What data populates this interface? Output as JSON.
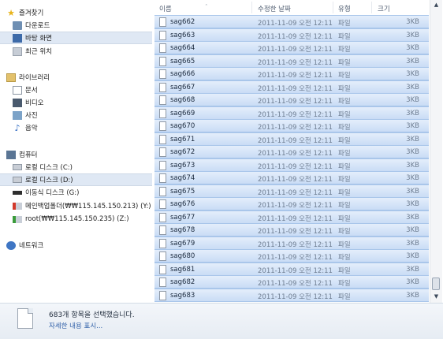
{
  "nav": {
    "favorites": {
      "header": "즐겨찾기",
      "items": [
        "다운로드",
        "바탕 화면",
        "최근 위치"
      ]
    },
    "libraries": {
      "header": "라이브러리",
      "items": [
        "문서",
        "비디오",
        "사진",
        "음악"
      ]
    },
    "computer": {
      "header": "컴퓨터",
      "items": [
        "로컬 디스크 (C:)",
        "로컬 디스크 (D:)",
        "이동식 디스크 (G:)",
        "메인백업폴더(₩₩115.145.150.213) (Y:)",
        "root(₩₩115.145.150.235) (Z:)"
      ]
    },
    "network": {
      "header": "네트워크"
    }
  },
  "columns": {
    "name": "이름",
    "date": "수정한 날짜",
    "type": "유형",
    "size": "크기"
  },
  "files": [
    {
      "name": "sag662",
      "date": "2011-11-09 오전 12:11",
      "type": "파일",
      "size": "3KB"
    },
    {
      "name": "sag663",
      "date": "2011-11-09 오전 12:11",
      "type": "파일",
      "size": "3KB"
    },
    {
      "name": "sag664",
      "date": "2011-11-09 오전 12:11",
      "type": "파일",
      "size": "3KB"
    },
    {
      "name": "sag665",
      "date": "2011-11-09 오전 12:11",
      "type": "파일",
      "size": "3KB"
    },
    {
      "name": "sag666",
      "date": "2011-11-09 오전 12:11",
      "type": "파일",
      "size": "3KB"
    },
    {
      "name": "sag667",
      "date": "2011-11-09 오전 12:11",
      "type": "파일",
      "size": "3KB"
    },
    {
      "name": "sag668",
      "date": "2011-11-09 오전 12:11",
      "type": "파일",
      "size": "3KB"
    },
    {
      "name": "sag669",
      "date": "2011-11-09 오전 12:11",
      "type": "파일",
      "size": "3KB"
    },
    {
      "name": "sag670",
      "date": "2011-11-09 오전 12:11",
      "type": "파일",
      "size": "3KB"
    },
    {
      "name": "sag671",
      "date": "2011-11-09 오전 12:11",
      "type": "파일",
      "size": "3KB"
    },
    {
      "name": "sag672",
      "date": "2011-11-09 오전 12:11",
      "type": "파일",
      "size": "3KB"
    },
    {
      "name": "sag673",
      "date": "2011-11-09 오전 12:11",
      "type": "파일",
      "size": "3KB"
    },
    {
      "name": "sag674",
      "date": "2011-11-09 오전 12:11",
      "type": "파일",
      "size": "3KB"
    },
    {
      "name": "sag675",
      "date": "2011-11-09 오전 12:11",
      "type": "파일",
      "size": "3KB"
    },
    {
      "name": "sag676",
      "date": "2011-11-09 오전 12:11",
      "type": "파일",
      "size": "3KB"
    },
    {
      "name": "sag677",
      "date": "2011-11-09 오전 12:11",
      "type": "파일",
      "size": "3KB"
    },
    {
      "name": "sag678",
      "date": "2011-11-09 오전 12:11",
      "type": "파일",
      "size": "3KB"
    },
    {
      "name": "sag679",
      "date": "2011-11-09 오전 12:11",
      "type": "파일",
      "size": "3KB"
    },
    {
      "name": "sag680",
      "date": "2011-11-09 오전 12:11",
      "type": "파일",
      "size": "3KB"
    },
    {
      "name": "sag681",
      "date": "2011-11-09 오전 12:11",
      "type": "파일",
      "size": "3KB"
    },
    {
      "name": "sag682",
      "date": "2011-11-09 오전 12:11",
      "type": "파일",
      "size": "3KB"
    },
    {
      "name": "sag683",
      "date": "2011-11-09 오전 12:11",
      "type": "파일",
      "size": "3KB"
    }
  ],
  "details": {
    "selected_text": "683개 항목을 선택했습니다.",
    "more_link": "자세한 내용 표시..."
  }
}
